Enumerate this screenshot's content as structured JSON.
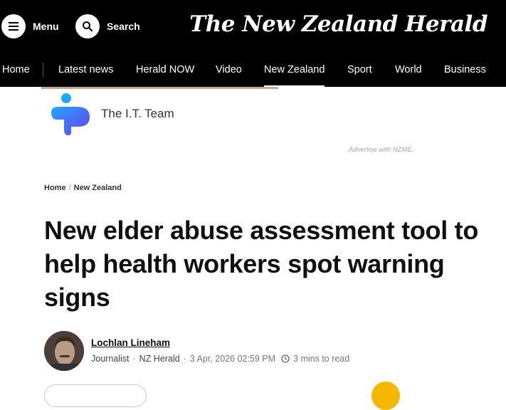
{
  "header": {
    "menu_label": "Menu",
    "search_label": "Search",
    "masthead": "The New Zealand Herald"
  },
  "nav": {
    "items": [
      "Home",
      "Latest news",
      "Herald NOW",
      "Video",
      "New Zealand",
      "Sport",
      "World",
      "Business"
    ],
    "active": "New Zealand"
  },
  "ad": {
    "brand": "The I.T. Team",
    "note": "Advertise with NZME."
  },
  "breadcrumb": [
    "Home",
    "New Zealand"
  ],
  "article": {
    "headline": "New elder abuse assessment tool to help health workers spot warning signs",
    "author": "Lochlan Lineham",
    "role": "Journalist",
    "outlet": "NZ Herald",
    "date": "3 Apr, 2026 02:59 PM",
    "read_time": "3 mins to read"
  },
  "colors": {
    "header_bg": "#000000",
    "accent": "#f5b800"
  }
}
